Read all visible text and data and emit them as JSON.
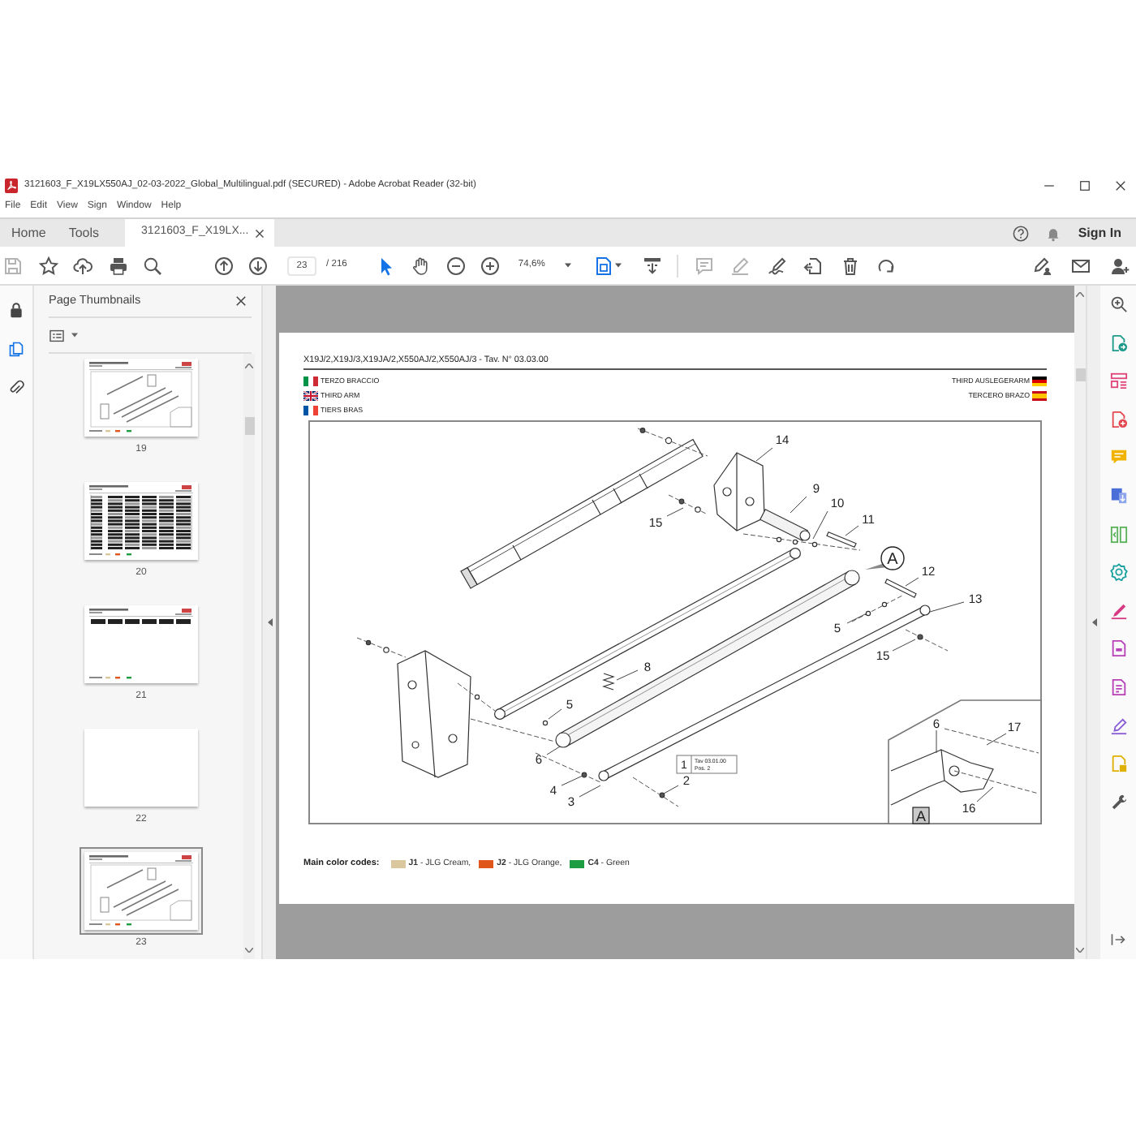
{
  "window": {
    "title": "3121603_F_X19LX550AJ_02-03-2022_Global_Multilingual.pdf (SECURED) - Adobe Acrobat Reader (32-bit)"
  },
  "menu": [
    "File",
    "Edit",
    "View",
    "Sign",
    "Window",
    "Help"
  ],
  "tabs": [
    {
      "label": "Home",
      "kind": "view",
      "selected": false
    },
    {
      "label": "Tools",
      "kind": "view",
      "selected": false
    },
    {
      "label": "3121603_F_X19LX...",
      "kind": "document",
      "selected": true
    }
  ],
  "account": {
    "sign_in": "Sign In"
  },
  "toolbar": {
    "page_number": "23",
    "page_count": "/ 216",
    "zoom": "74,6%",
    "modes": [
      {
        "selected": true
      },
      {
        "selected": false
      }
    ]
  },
  "side_rail": [
    {
      "selected": false
    },
    {
      "selected": true
    },
    {
      "selected": false
    }
  ],
  "thumbnails_panel": {
    "title": "Page Thumbnails",
    "thumbnails": [
      {
        "label": "19",
        "kind": "diagram",
        "selected": false
      },
      {
        "label": "20",
        "kind": "table",
        "selected": false
      },
      {
        "label": "21",
        "kind": "header",
        "selected": false
      },
      {
        "label": "22",
        "kind": "blank",
        "selected": false
      },
      {
        "label": "23",
        "kind": "diagram",
        "selected": true
      }
    ]
  },
  "page": {
    "header": "X19J/2,X19J/3,X19JA/2,X550AJ/2,X550AJ/3 - Tav. N° 03.03.00",
    "titles_left": [
      {
        "text": "TERZO BRACCIO",
        "kind": "italian"
      },
      {
        "text": "THIRD ARM",
        "kind": "british"
      },
      {
        "text": "TIERS BRAS",
        "kind": "french"
      }
    ],
    "titles_right": [
      {
        "text": "THIRD AUSLEGERARM",
        "kind": "german"
      },
      {
        "text": "TERCERO BRAZO",
        "kind": "spanish"
      }
    ],
    "diagram": {
      "callouts": [
        "14",
        "9",
        "10",
        "11",
        "15",
        "12",
        "13",
        "5",
        "15",
        "8",
        "5",
        "6",
        "4",
        "3",
        "2"
      ],
      "detail_marker": "A",
      "note": {
        "number": "1",
        "lines": [
          "Tav 03.01.00",
          "Pos. 2"
        ]
      },
      "inset": {
        "label": "A",
        "callouts": [
          "6",
          "17",
          "16"
        ]
      }
    },
    "color_codes": {
      "label": "Main color codes:",
      "items": [
        {
          "text": "**J1** - JLG Cream,",
          "color": "#dac79e"
        },
        {
          "text": "**J2** - JLG Orange,",
          "color": "#e0561c"
        },
        {
          "text": "**C4** - Green",
          "color": "#1f9d43"
        }
      ]
    }
  }
}
